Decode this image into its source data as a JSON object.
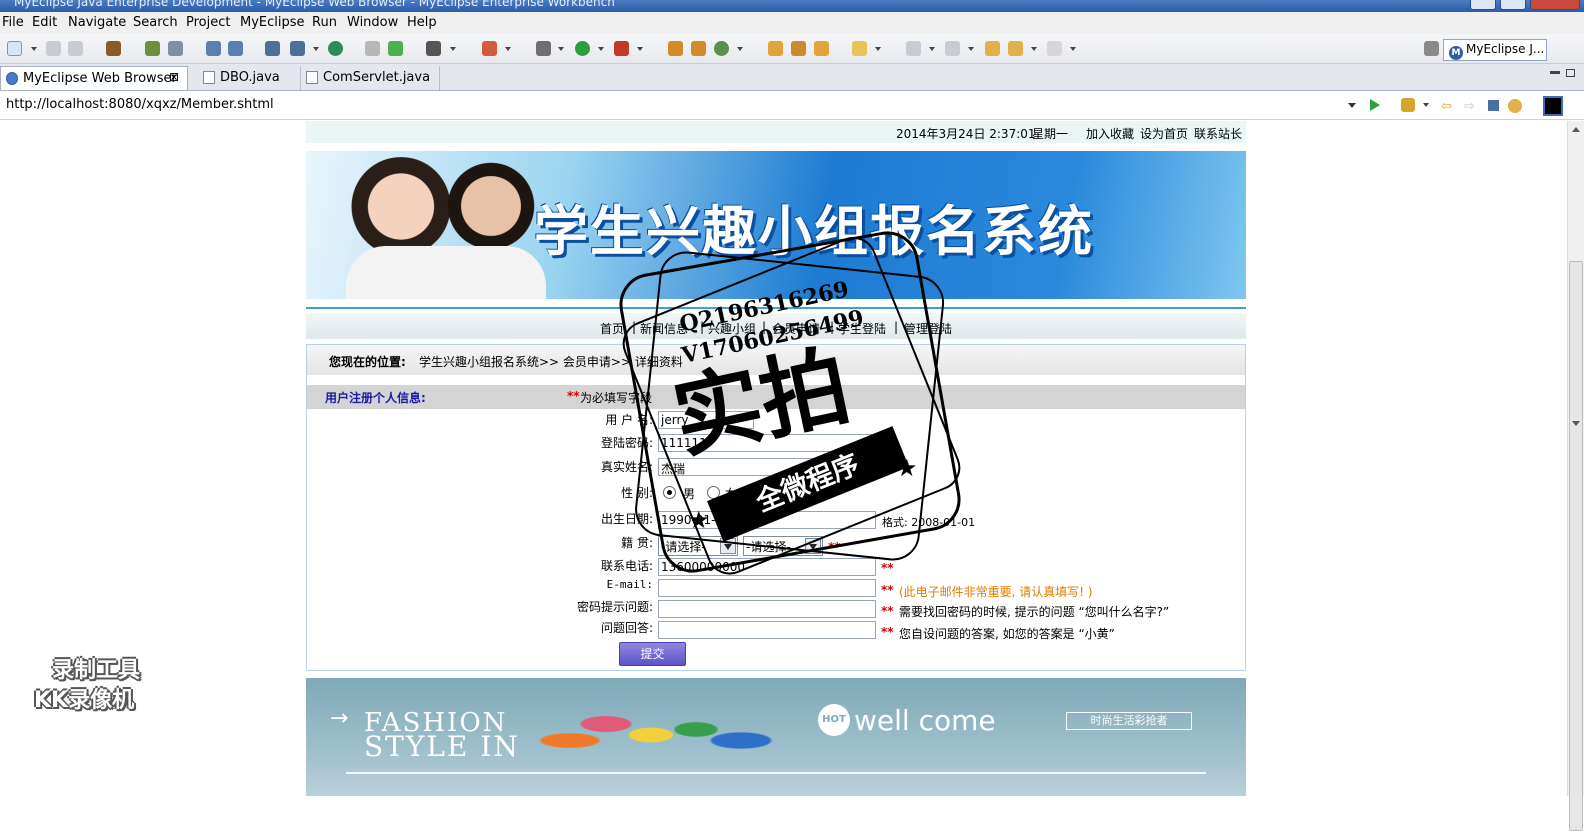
{
  "window": {
    "title": "MyEclipse Java Enterprise Development - MyEclipse Web Browser - MyEclipse Enterprise Workbench"
  },
  "menu": [
    "File",
    "Edit",
    "Navigate",
    "Search",
    "Project",
    "MyEclipse",
    "Run",
    "Window",
    "Help"
  ],
  "perspective": {
    "label": "MyEclipse J..."
  },
  "tabs": [
    {
      "label": "MyEclipse Web Browser",
      "active": true
    },
    {
      "label": "DBO.java",
      "active": false
    },
    {
      "label": "ComServlet.java",
      "active": false
    }
  ],
  "address": {
    "url": "http://localhost:8080/xqxz/Member.shtml"
  },
  "site": {
    "topbar": {
      "datetime": "2014年3月24日 2:37:01",
      "weekday": "星期一",
      "links": [
        "加入收藏",
        "设为首页",
        "联系站长"
      ]
    },
    "banner_title": "学生兴趣小组报名系统",
    "nav": [
      "首页",
      "新闻信息",
      "兴趣小组",
      "会员申请",
      "学生登陆",
      "管理登陆"
    ],
    "nav_separator": "|",
    "location": {
      "label": "您现在的位置:",
      "path": "学生兴趣小组报名系统>> 会员申请>> 详细资料"
    },
    "form": {
      "heading": "用户注册个人信息:",
      "required_note": "为必填写字段",
      "required_mark": "**",
      "fields": {
        "username": {
          "label": "用 户 名:",
          "value": "jerry"
        },
        "password": {
          "label": "登陆密码:",
          "value": "111111"
        },
        "realname": {
          "label": "真实姓名:",
          "value": "杰瑞"
        },
        "gender": {
          "label": "性    别:",
          "options": [
            "男",
            "女"
          ],
          "selected": "男"
        },
        "birthday": {
          "label": "出生日期:",
          "value": "1990-01-01",
          "hint": "格式: 2008-01-01"
        },
        "hometown": {
          "label": "籍    贯:",
          "province": "-请选择-",
          "city": "-请选择-"
        },
        "phone": {
          "label": "联系电话:",
          "value": "13600000000"
        },
        "email": {
          "label": "E-mail:",
          "value": "",
          "hint": "(此电子邮件非常重要, 请认真填写! )"
        },
        "question": {
          "label": "密码提示问题:",
          "value": "",
          "hint": "需要找回密码的时候, 提示的问题 “您叫什么名字?”"
        },
        "answer": {
          "label": "问题回答:",
          "value": "",
          "hint": "您自设问题的答案, 如您的答案是 “小黄”"
        }
      },
      "submit_label": "提交"
    },
    "fashion_banner": {
      "line1": "FASHION",
      "line2": "STYLE IN",
      "hot": "HOT",
      "welcome": "well come",
      "button": "时尚生活彩抢者"
    }
  },
  "overlays": {
    "stamp": {
      "qq": "Q2196316269",
      "wx": "V17060256499",
      "main": "实拍",
      "ribbon": "全微程序"
    },
    "recorder": {
      "line1": "录制工具",
      "line2": "KK录像机"
    }
  },
  "colors": {
    "titlebar": "#2b5ca8",
    "banner_blue": "#1d7bd2",
    "submit": "#6a61cf",
    "required_red": "#d40000",
    "nav_bg": "#e6eef0"
  }
}
